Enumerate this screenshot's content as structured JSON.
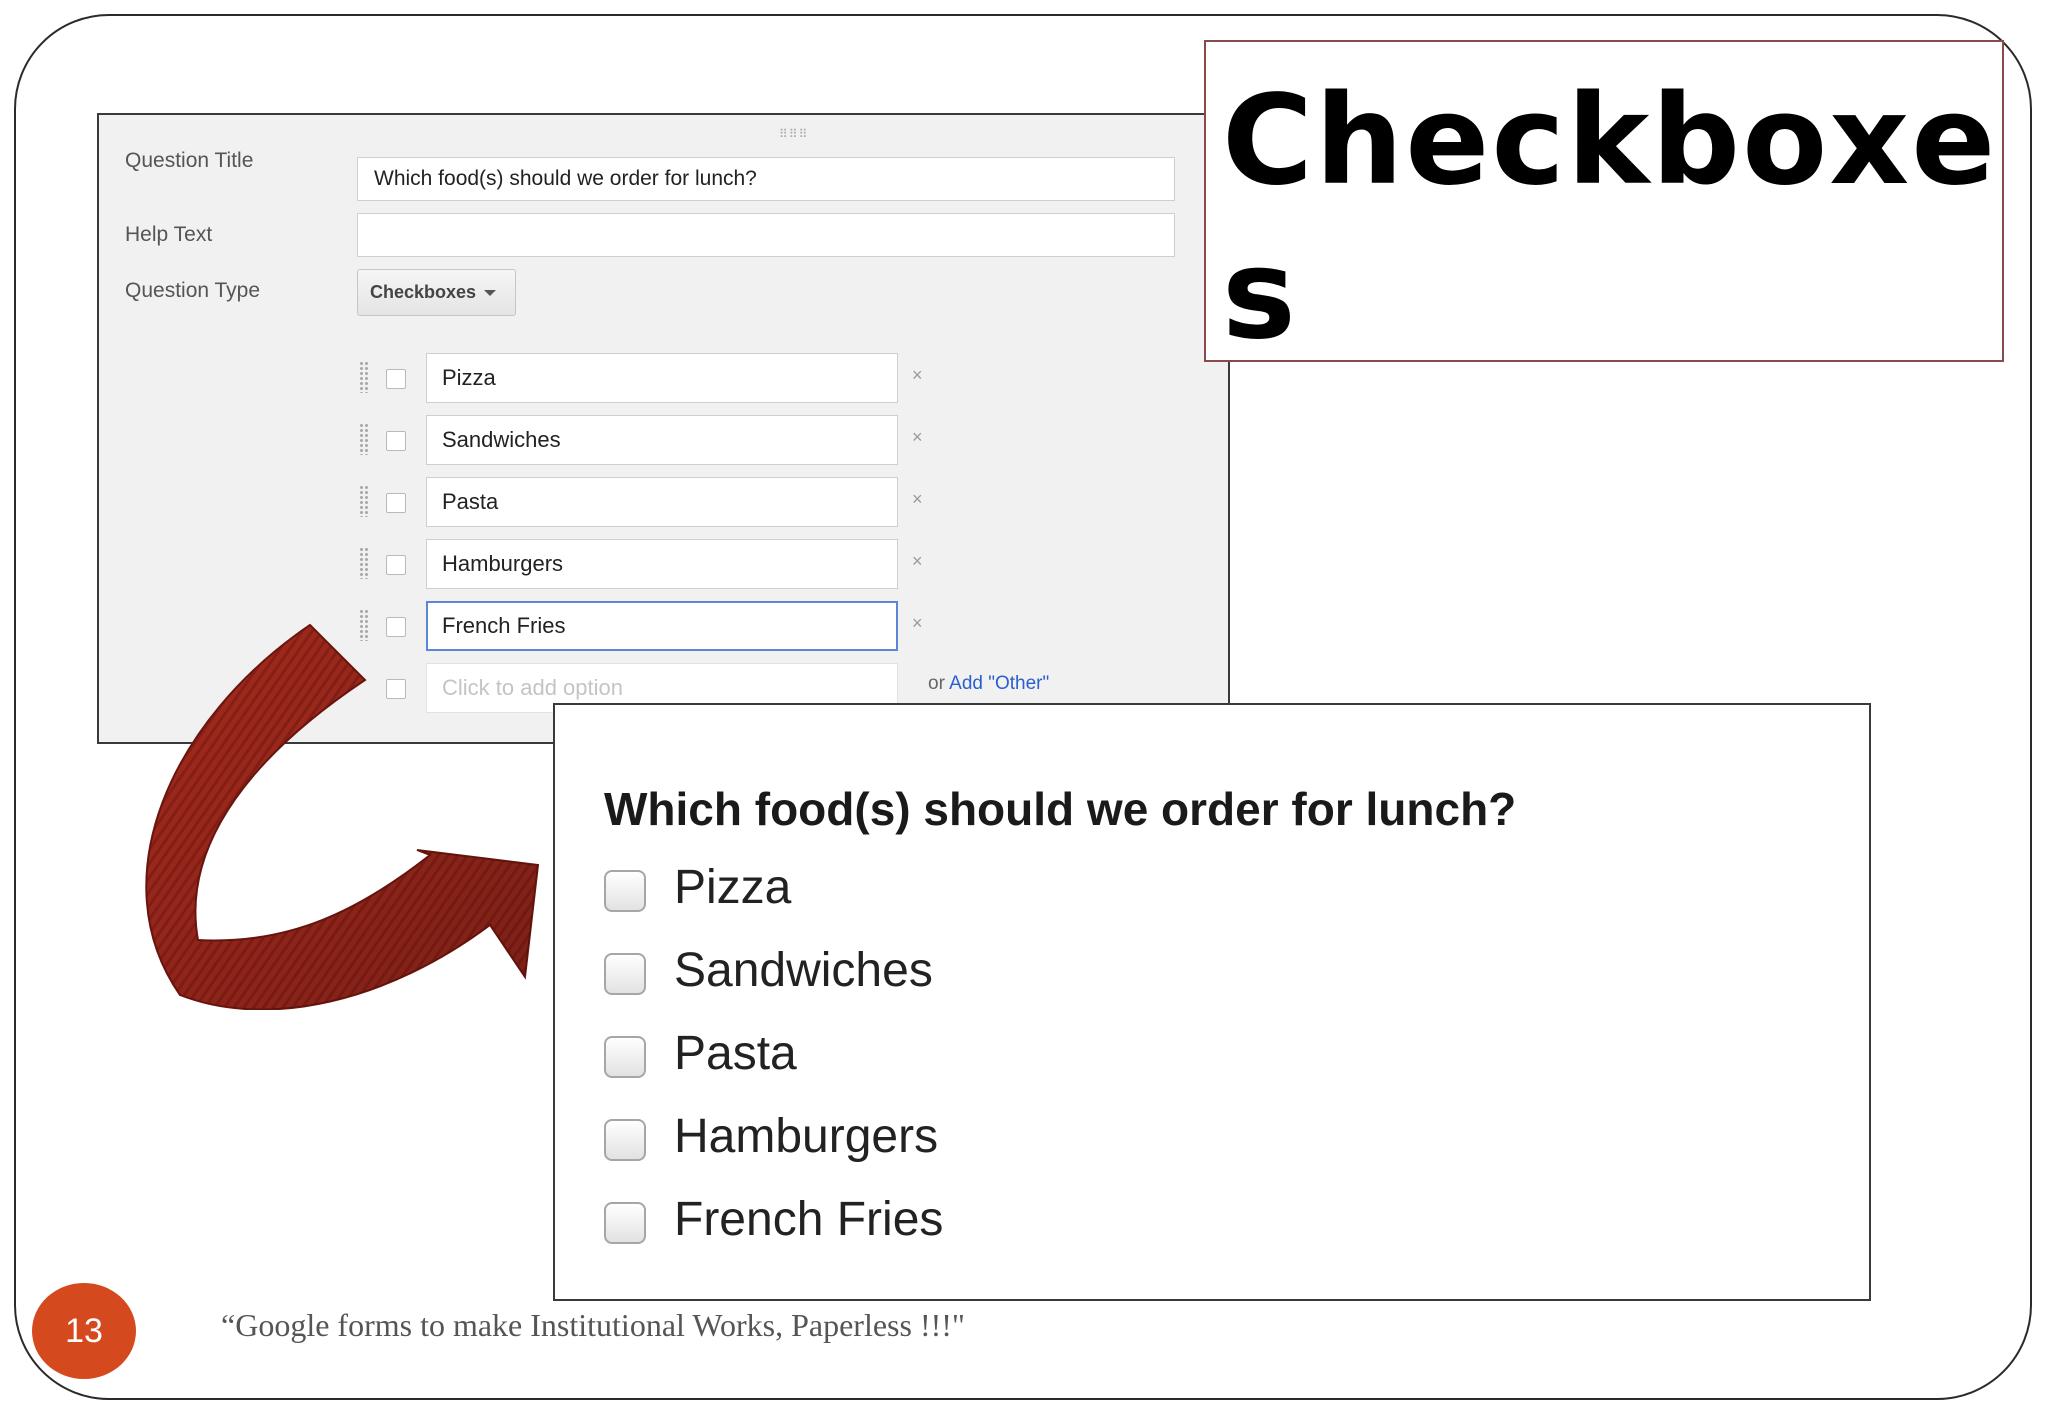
{
  "editor": {
    "labels": {
      "question_title": "Question Title",
      "help_text": "Help Text",
      "question_type": "Question Type"
    },
    "question_title_value": "Which food(s) should we order for lunch?",
    "help_text_value": "",
    "question_type_value": "Checkboxes",
    "options": [
      "Pizza",
      "Sandwiches",
      "Pasta",
      "Hamburgers",
      "French Fries"
    ],
    "focused_option": "French Fries",
    "remove_symbol": "×",
    "add_option_placeholder": "Click to add option",
    "add_other_prefix": "or",
    "add_other_link": "Add \"Other\""
  },
  "slide": {
    "title": "Checkboxes",
    "page_number": "13",
    "footer": "“Google forms to make Institutional Works, Paperless !!!\""
  },
  "preview": {
    "question": "Which food(s) should we order for lunch?",
    "options": [
      "Pizza",
      "Sandwiches",
      "Pasta",
      "Hamburgers",
      "French Fries"
    ]
  },
  "colors": {
    "badge": "#d44a1e",
    "arrow": "#a52a1e",
    "title_border": "#8b4a4a",
    "focus_border": "#5a86d8",
    "link": "#2a5fcf"
  },
  "icons": {
    "drag_handle": "drag-handle-icon",
    "remove": "close-icon",
    "dropdown": "chevron-down-icon",
    "arrow": "curved-arrow-icon"
  }
}
